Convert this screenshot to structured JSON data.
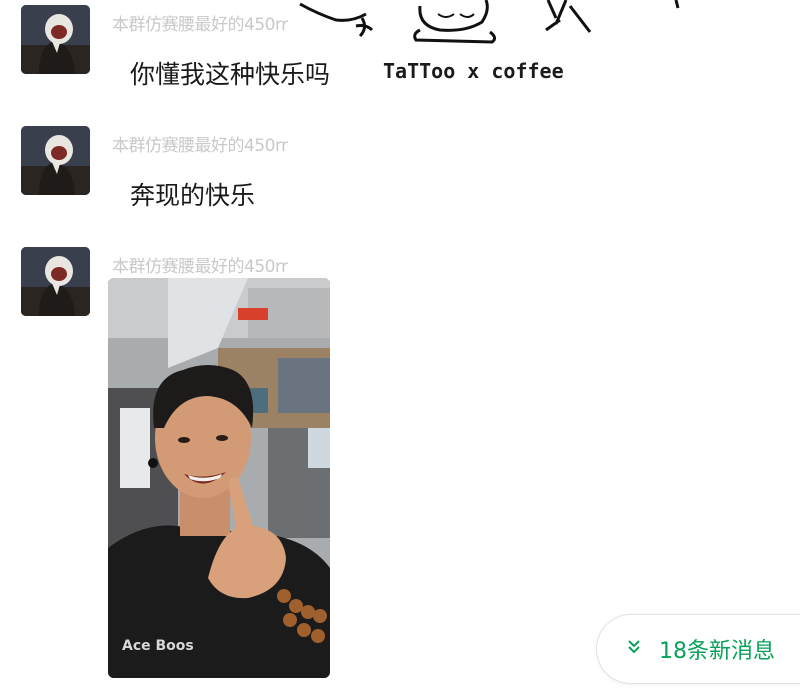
{
  "messages": [
    {
      "sender": "本群仿赛腰最好的450rr",
      "text": "你懂我这种快乐吗",
      "sticker_text": "TaTToo x coffee"
    },
    {
      "sender": "本群仿赛腰最好的450rr",
      "text": "奔现的快乐"
    },
    {
      "sender": "本群仿赛腰最好的450rr",
      "image": "selfie-photo",
      "photo_shirt_text": "Ace Boos"
    }
  ],
  "new_messages": {
    "icon": "double-chevron-down-icon",
    "label": "18条新消息"
  },
  "colors": {
    "accent": "#07a15a",
    "nickname": "#c9c9c9",
    "text": "#1b1b1b"
  }
}
